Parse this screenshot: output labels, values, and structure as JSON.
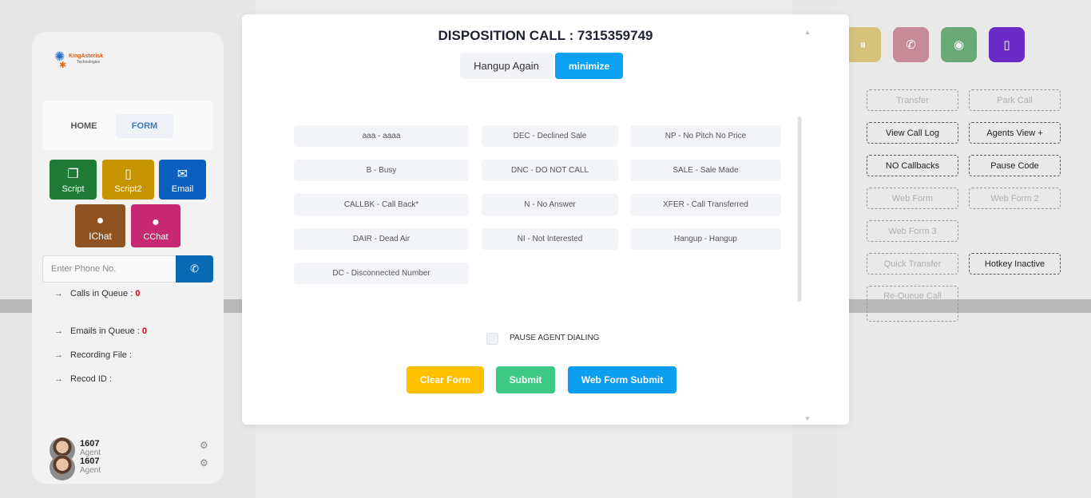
{
  "app": {
    "logo": {
      "brand": "KingAsterisk",
      "sub": "Technologies"
    },
    "nav": {
      "home": "HOME",
      "form": "FORM"
    },
    "tiles": {
      "script": "Script",
      "script2": "Script2",
      "email": "Email",
      "ichat": "IChat",
      "cchat": "CChat"
    },
    "phone_placeholder": "Enter Phone No.",
    "info": {
      "calls_label": "Calls in Queue :",
      "calls_value": "0",
      "emails_label": "Emails in Queue :",
      "emails_value": "0",
      "recording_label": "Recording File :",
      "record_id_label": "Recod ID :"
    },
    "agents": [
      {
        "number": "1607",
        "role": "Agent"
      },
      {
        "number": "1607",
        "role": "Agent"
      }
    ],
    "right_buttons": {
      "transfer": "Transfer",
      "park_call": "Park Call",
      "view_call_log": "View Call Log",
      "agents_view": "Agents View +",
      "no_callbacks": "NO Callbacks",
      "pause_code": "Pause Code",
      "web_form": "Web Form",
      "web_form_2": "Web Form 2",
      "web_form_3": "Web Form 3",
      "quick_transfer": "Quick Transfer",
      "hotkey_inactive": "Hotkey Inactive",
      "requeue_call": "Re-Queue Call"
    }
  },
  "modal": {
    "title": "DISPOSITION CALL : 7315359749",
    "hangup_again": "Hangup Again",
    "minimize": "minimize",
    "dispositions": [
      "aaa - aaaa",
      "DEC - Declined Sale",
      "NP - No Pitch No Price",
      "B - Busy",
      "DNC - DO NOT CALL",
      "SALE - Sale Made",
      "CALLBK - Call Back*",
      "N - No Answer",
      "XFER - Call Transferred",
      "DAIR - Dead Air",
      "NI - Not Interested",
      "Hangup - Hangup",
      "DC - Disconnected Number"
    ],
    "pause_label": "PAUSE AGENT DIALING",
    "clear_form": "Clear Form",
    "submit": "Submit",
    "web_form_submit": "Web Form Submit"
  },
  "icons": {
    "script": "file-icon",
    "script2": "file-icon",
    "email": "envelope-icon",
    "ichat": "chat-icon",
    "cchat": "chats-icon",
    "dial": "phone-icon",
    "pause": "pause-icon",
    "hangup": "phone-hangup-icon",
    "record": "record-icon",
    "mobile": "mobile-icon",
    "settings": "gear-icon"
  },
  "colors": {
    "primary": "#0da1f3",
    "warning": "#ffc000",
    "success": "#3dc884",
    "title": "#1f2133",
    "queue_count": "#d0021b"
  }
}
